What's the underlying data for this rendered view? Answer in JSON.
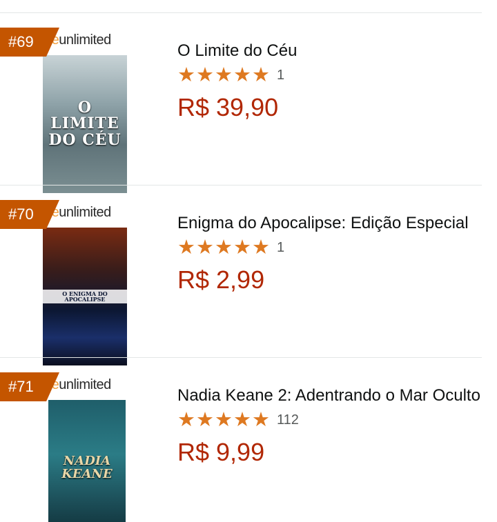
{
  "items": [
    {
      "rank": "#69",
      "ku_badge": {
        "prefix": "dle",
        "suffix": "unlimited"
      },
      "cover_title": "O LIMITE DO CÉU",
      "title": "O Limite do Céu",
      "rating_stars": 5,
      "rating_count": "1",
      "price": "R$ 39,90"
    },
    {
      "rank": "#70",
      "ku_badge": {
        "prefix": "dle",
        "suffix": "unlimited"
      },
      "cover_title": "O ENIGMA DO APOCALIPSE",
      "title": "Enigma do Apocalipse: Edição Especial",
      "rating_stars": 5,
      "rating_count": "1",
      "price": "R$ 2,99"
    },
    {
      "rank": "#71",
      "ku_badge": {
        "prefix": "dle",
        "suffix": "unlimited"
      },
      "cover_title": "NADIA KEANE",
      "title": "Nadia Keane 2: Adentrando o Mar Oculto",
      "rating_stars": 5,
      "rating_count": "112",
      "price": "R$ 9,99"
    }
  ],
  "colors": {
    "badge": "#c45500",
    "star": "#de7921",
    "price": "#b12704",
    "divider": "#e3e6e6"
  },
  "icons": {
    "star": "star-icon"
  }
}
